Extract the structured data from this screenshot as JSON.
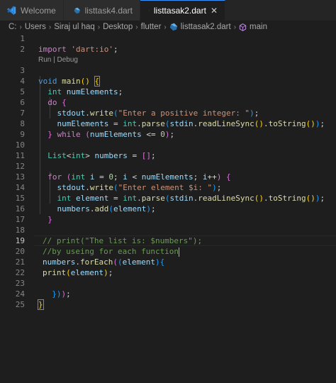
{
  "tabs": [
    {
      "label": "Welcome",
      "icon": "vscode-icon"
    },
    {
      "label": "listtask4.dart",
      "icon": "dart-icon"
    },
    {
      "label": "listtasak2.dart",
      "icon": "dart-icon",
      "active": true
    }
  ],
  "breadcrumb": {
    "parts": [
      "C:",
      "Users",
      "Siraj ul haq",
      "Desktop",
      "flutter",
      "listtasak2.dart",
      "main"
    ]
  },
  "codelens": "Run | Debug",
  "line_numbers": [
    "1",
    "2",
    "3",
    "4",
    "5",
    "6",
    "7",
    "8",
    "9",
    "10",
    "11",
    "12",
    "13",
    "14",
    "15",
    "16",
    "17",
    "18",
    "19",
    "20",
    "21",
    "22",
    "23",
    "24",
    "25"
  ],
  "code": {
    "l1": [
      "import",
      "'dart:io'",
      ";"
    ],
    "l3": [
      "void",
      "main",
      "(",
      ")",
      "{"
    ],
    "l4": [
      "int",
      "numElements",
      ";"
    ],
    "l5": [
      "do",
      "{"
    ],
    "l6": [
      "stdout",
      ".",
      "write",
      "(",
      "\"Enter a positive integer: \"",
      ")",
      ";"
    ],
    "l7": [
      "numElements",
      " = ",
      "int",
      ".",
      "parse",
      "(",
      "stdin",
      ".",
      "readLineSync",
      "(",
      ")",
      ".",
      "toString",
      "(",
      ")",
      ")",
      ";"
    ],
    "l8": [
      "}",
      "while",
      "(",
      "numElements",
      " <= ",
      "0",
      ")",
      ";"
    ],
    "l10": [
      "List",
      "<",
      "int",
      ">",
      "numbers",
      " = ",
      "[",
      "]",
      ";"
    ],
    "l12": [
      "for",
      "(",
      "int",
      "i",
      " = ",
      "0",
      "; ",
      "i",
      " < ",
      "numElements",
      "; ",
      "i",
      "++",
      ")",
      "{"
    ],
    "l13": [
      "stdout",
      ".",
      "write",
      "(",
      "\"Enter element $i: \"",
      ")",
      ";"
    ],
    "l14": [
      "int",
      "element",
      " = ",
      "int",
      ".",
      "parse",
      "(",
      "stdin",
      ".",
      "readLineSync",
      "(",
      ")",
      ".",
      "toString",
      "(",
      ")",
      ")",
      ";"
    ],
    "l15": [
      "numbers",
      ".",
      "add",
      "(",
      "element",
      ")",
      ";"
    ],
    "l16": [
      "}"
    ],
    "l18": [
      "// print(\"The list is: $numbers\");"
    ],
    "l19": [
      "//by useing for each function"
    ],
    "l20": [
      "numbers",
      ".",
      "forEach",
      "(",
      "(",
      "element",
      ")",
      "{"
    ],
    "l21": [
      "print",
      "(",
      "element",
      ")",
      ";"
    ],
    "l23": [
      "}",
      ")",
      ")",
      ";"
    ],
    "l24": [
      "}"
    ]
  },
  "colors": {
    "background": "#1e1e1e",
    "keyword": "#569cd6",
    "control": "#c586c0",
    "type": "#4ec9b0",
    "variable": "#9cdcfe",
    "function": "#dcdcaa",
    "string": "#ce9178",
    "number": "#b5cea8",
    "comment": "#6a9955",
    "accent": "#3794ff"
  }
}
